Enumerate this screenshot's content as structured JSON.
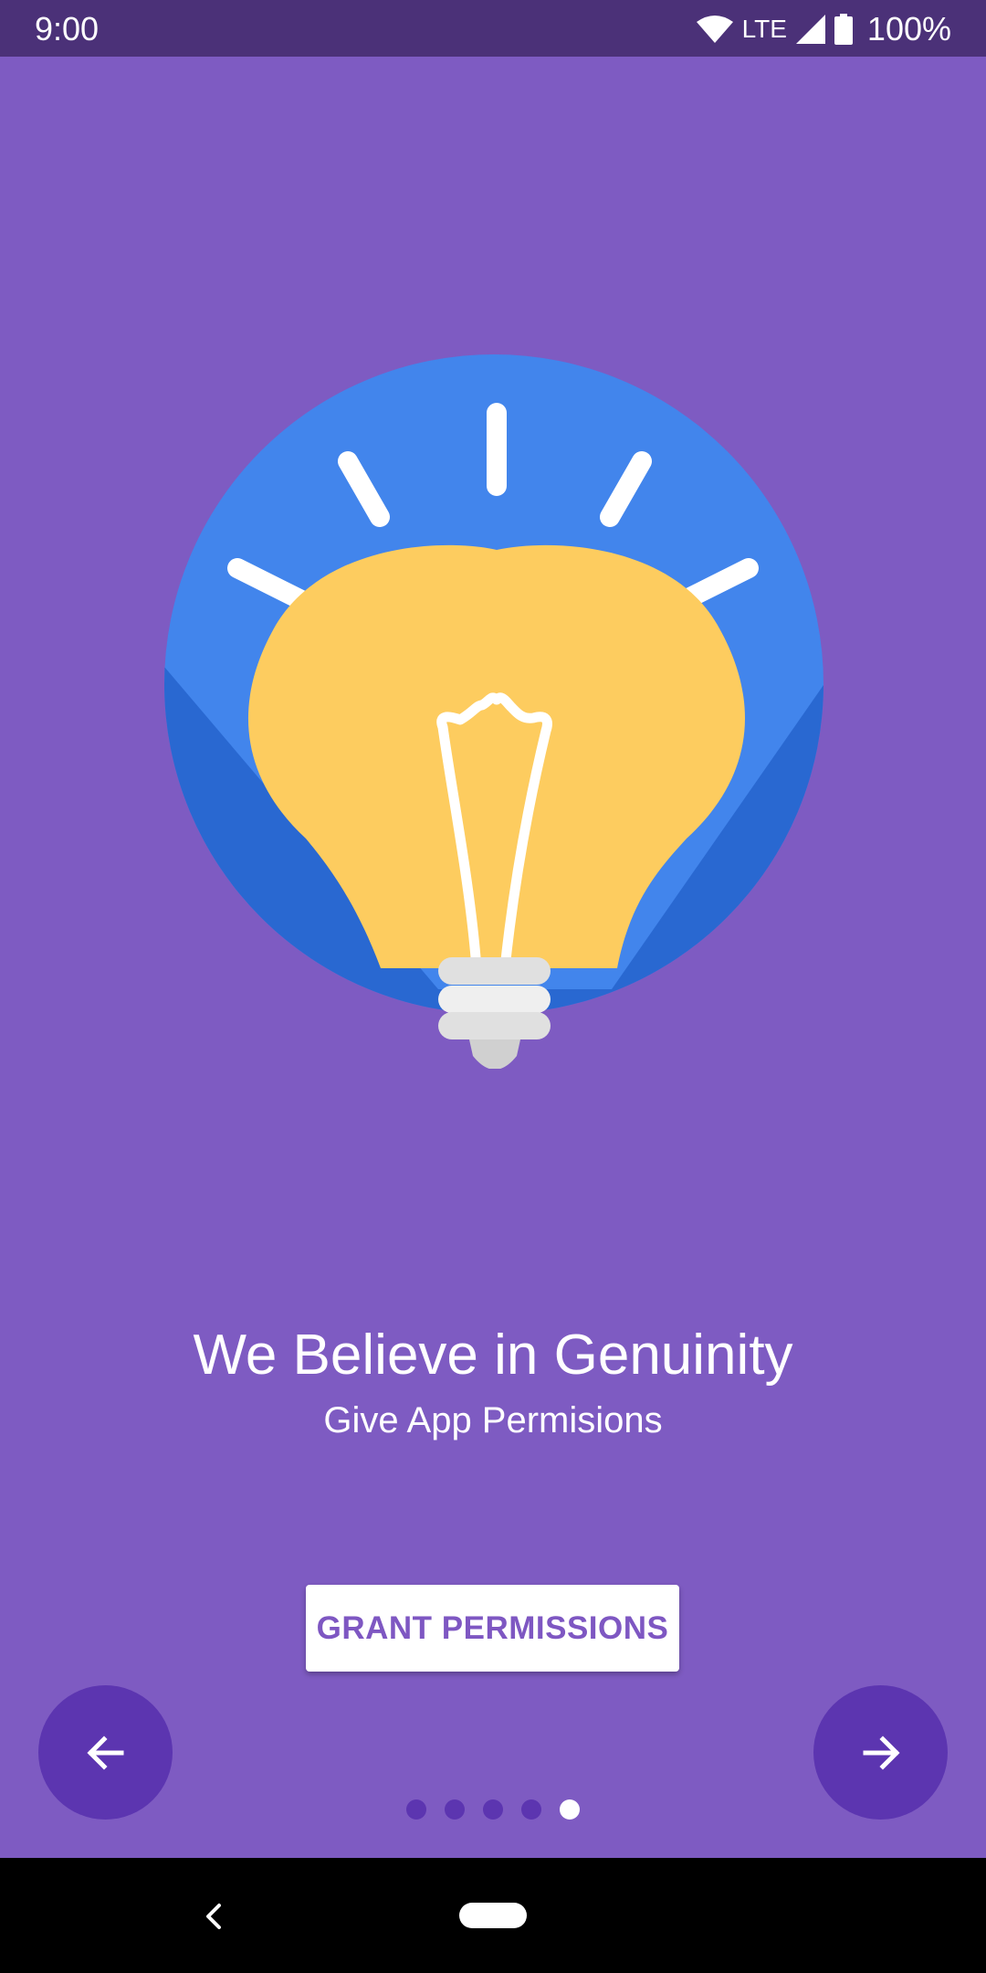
{
  "status_bar": {
    "time": "9:00",
    "network": "LTE",
    "battery": "100%",
    "icons": [
      "wifi-icon",
      "cell-signal-icon",
      "battery-icon"
    ]
  },
  "illustration": {
    "icon": "lightbulb-icon",
    "colors": {
      "circle": "#4285ec",
      "circle_shadow": "#2968d1",
      "bulb": "#fdcc5f",
      "rays": "#ffffff",
      "base": "#e0e0e0"
    }
  },
  "content": {
    "title": "We Believe in Genuinity",
    "subtitle": "Give App Permisions"
  },
  "actions": {
    "grant_label": "GRANT PERMISSIONS",
    "prev_icon": "arrow-left-icon",
    "next_icon": "arrow-right-icon"
  },
  "pager": {
    "total": 5,
    "current": 5
  },
  "theme": {
    "background": "#7e5bc2",
    "status_bar": "#4b3178",
    "accent": "#5c35b0",
    "button_text": "#7e57c2"
  },
  "nav_bar": {
    "icons": [
      "back-icon",
      "home-pill-icon"
    ]
  }
}
